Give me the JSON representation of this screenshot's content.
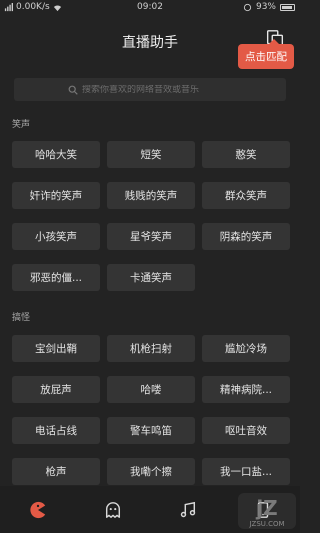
{
  "status_bar": {
    "network_speed": "0.00K/s",
    "time": "09:02",
    "battery": "93%"
  },
  "header": {
    "title": "直播助手",
    "copy_icon": "copy-icon"
  },
  "tooltip": {
    "text": "点击匹配"
  },
  "search": {
    "placeholder": "搜索你喜欢的网络音效或音乐",
    "icon": "search-icon"
  },
  "sections": [
    {
      "title": "笑声",
      "items": [
        "哈哈大笑",
        "短笑",
        "憨笑",
        "奸诈的笑声",
        "贱贱的笑声",
        "群众笑声",
        "小孩笑声",
        "星爷笑声",
        "阴森的笑声",
        "邪恶的僵...",
        "卡通笑声"
      ]
    },
    {
      "title": "搞怪",
      "items": [
        "宝剑出鞘",
        "机枪扫射",
        "尴尬冷场",
        "放屁声",
        "哈喽",
        "精神病院...",
        "电话占线",
        "警车鸣笛",
        "呕吐音效",
        "枪声",
        "我嘞个擦",
        "我一口盐..."
      ]
    }
  ],
  "bottom_nav": [
    {
      "name": "pacman-icon",
      "active": true
    },
    {
      "name": "ghost-icon",
      "active": false
    },
    {
      "name": "music-note-icon",
      "active": false
    },
    {
      "name": "phone-icon",
      "active": false
    }
  ],
  "watermark": {
    "text": "JZSU.COM",
    "logo_letters": "jZ"
  },
  "colors": {
    "accent": "#e35a46",
    "chip_bg": "#343434",
    "bg": "#232323"
  }
}
